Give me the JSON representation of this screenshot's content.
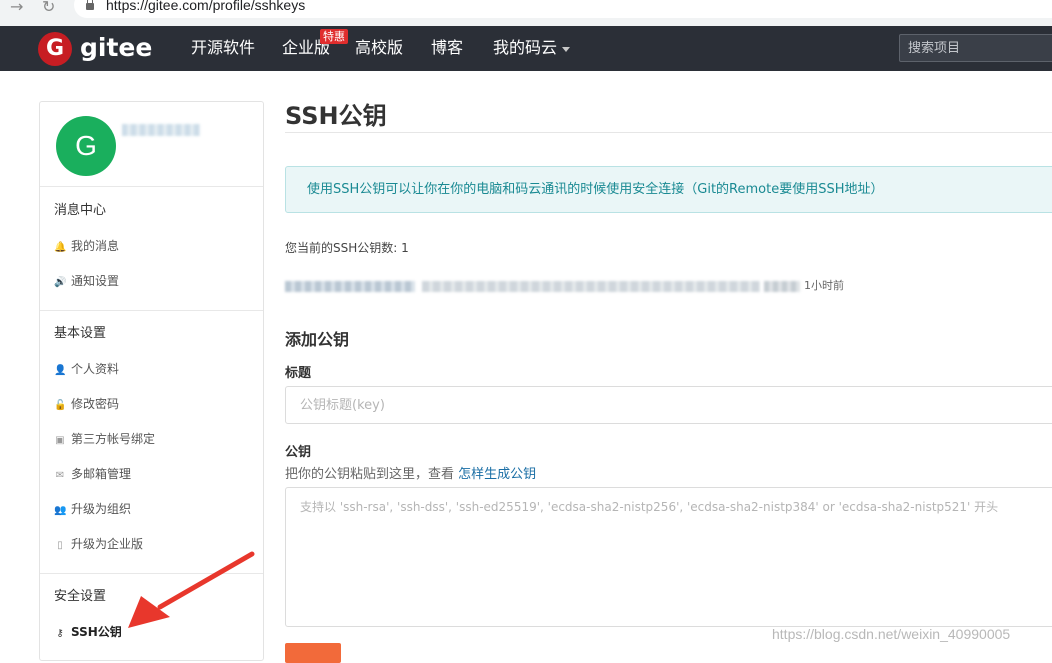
{
  "browser": {
    "url": "https://gitee.com/profile/sshkeys",
    "back_icon": "arrow-right-icon",
    "reload_icon": "reload-icon"
  },
  "header": {
    "logo_letter": "G",
    "logo_text": "gitee",
    "nav": [
      {
        "label": "开源软件"
      },
      {
        "label": "企业版"
      },
      {
        "label": "高校版"
      },
      {
        "label": "博客"
      },
      {
        "label": "我的码云"
      }
    ],
    "badge": "特惠",
    "search_placeholder": "搜索项目"
  },
  "sidebar": {
    "avatar_letter": "G",
    "sections": [
      {
        "title": "消息中心",
        "items": [
          {
            "label": "我的消息",
            "icon": "bell-icon"
          },
          {
            "label": "通知设置",
            "icon": "speaker-icon"
          }
        ]
      },
      {
        "title": "基本设置",
        "items": [
          {
            "label": "个人资料",
            "icon": "user-icon"
          },
          {
            "label": "修改密码",
            "icon": "unlock-icon"
          },
          {
            "label": "第三方帐号绑定",
            "icon": "id-card-icon"
          },
          {
            "label": "多邮箱管理",
            "icon": "envelope-icon"
          },
          {
            "label": "升级为组织",
            "icon": "group-icon"
          },
          {
            "label": "升级为企业版",
            "icon": "building-icon"
          }
        ]
      },
      {
        "title": "安全设置",
        "items": [
          {
            "label": "SSH公钥",
            "icon": "key-icon",
            "active": true
          }
        ]
      }
    ]
  },
  "main": {
    "title": "SSH公钥",
    "info": "使用SSH公钥可以让你在你的电脑和码云通讯的时候使用安全连接（Git的Remote要使用SSH地址）",
    "key_count": "您当前的SSH公钥数: 1",
    "key_time": "1小时前",
    "add_title": "添加公钥",
    "title_label": "标题",
    "title_placeholder": "公钥标题(key)",
    "key_label": "公钥",
    "hint_text": "把你的公钥粘贴到这里，查看",
    "hint_link": "怎样生成公钥",
    "key_placeholder": "支持以 'ssh-rsa', 'ssh-dss', 'ssh-ed25519', 'ecdsa-sha2-nistp256', 'ecdsa-sha2-nistp384' or 'ecdsa-sha2-nistp521' 开头"
  },
  "watermark": "https://blog.csdn.net/weixin_40990005",
  "colors": {
    "header_bg": "#2b2f37",
    "brand_red": "#c71d23",
    "avatar_green": "#1aaf5d",
    "info_text": "#1a8a93",
    "link": "#1a6ea5",
    "submit": "#f26a3a",
    "arrow_red": "#e8372c"
  }
}
